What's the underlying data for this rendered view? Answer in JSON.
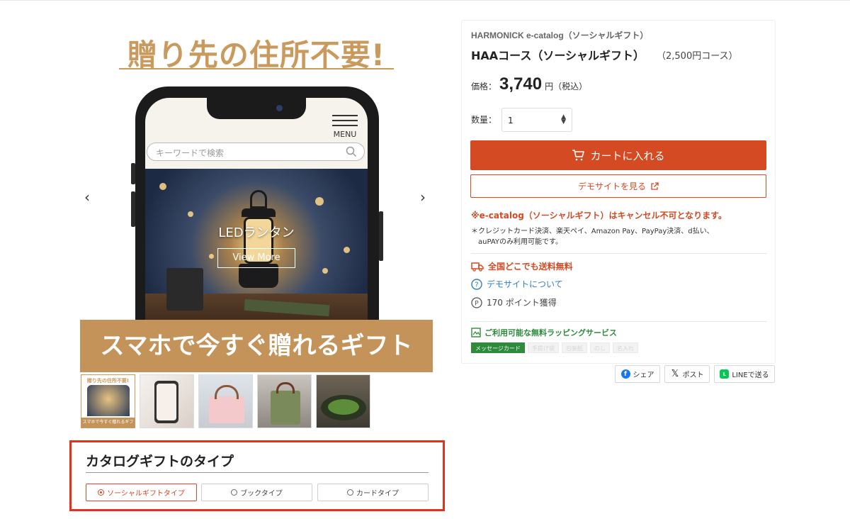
{
  "hero": {
    "headline": "贈り先の住所不要!",
    "menu_label": "MENU",
    "search_placeholder": "キーワードで検索",
    "photo_title": "LEDランタン",
    "photo_button": "View More",
    "banner": "スマホで今すぐ贈れるギフト",
    "prev_arrow": "‹",
    "next_arrow": "›"
  },
  "thumbnails": {
    "first_title": "贈り先の住所不要!",
    "first_band": "スマホで今すぐ贈れるギフト"
  },
  "catalog_type": {
    "title": "カタログギフトのタイプ",
    "options": [
      {
        "label": "ソーシャルギフトタイプ",
        "selected": true
      },
      {
        "label": "ブックタイプ",
        "selected": false
      },
      {
        "label": "カードタイプ",
        "selected": false
      }
    ]
  },
  "product": {
    "brand": "HARMONICK e-catalog（ソーシャルギフト）",
    "name": "HAAコース（ソーシャルギフト）",
    "course": "（2,500円コース）",
    "price_label": "価格：",
    "price_value": "3,740",
    "price_unit": "円（税込）",
    "qty_label": "数量：",
    "qty_value": "1",
    "cart_button": "カートに入れる",
    "demo_button": "デモサイトを見る",
    "cancel_notice": "※e-catalog（ソーシャルギフト）はキャンセル不可となります。",
    "payment_note_1": "＊クレジットカード決済、楽天ペイ、Amazon Pay、PayPay決済、d払い、",
    "payment_note_2": "auPAYのみ利用可能です。",
    "free_shipping": "全国どこでも送料無料",
    "demo_site_link": "デモサイトについて",
    "points": "170 ポイント獲得",
    "wrapping_title": "ご利用可能な無料ラッピングサービス",
    "wrapping_tags": [
      "メッセージカード",
      "手提げ袋",
      "包装紙",
      "のし",
      "名入れ"
    ],
    "accent_color": "#d34a23",
    "link_color": "#2f7fc5",
    "wrap_color": "#2e8b3c"
  },
  "share": {
    "facebook": "シェア",
    "x": "ポスト",
    "line": "LINEで送る"
  },
  "highlight_color": "#e0321c"
}
